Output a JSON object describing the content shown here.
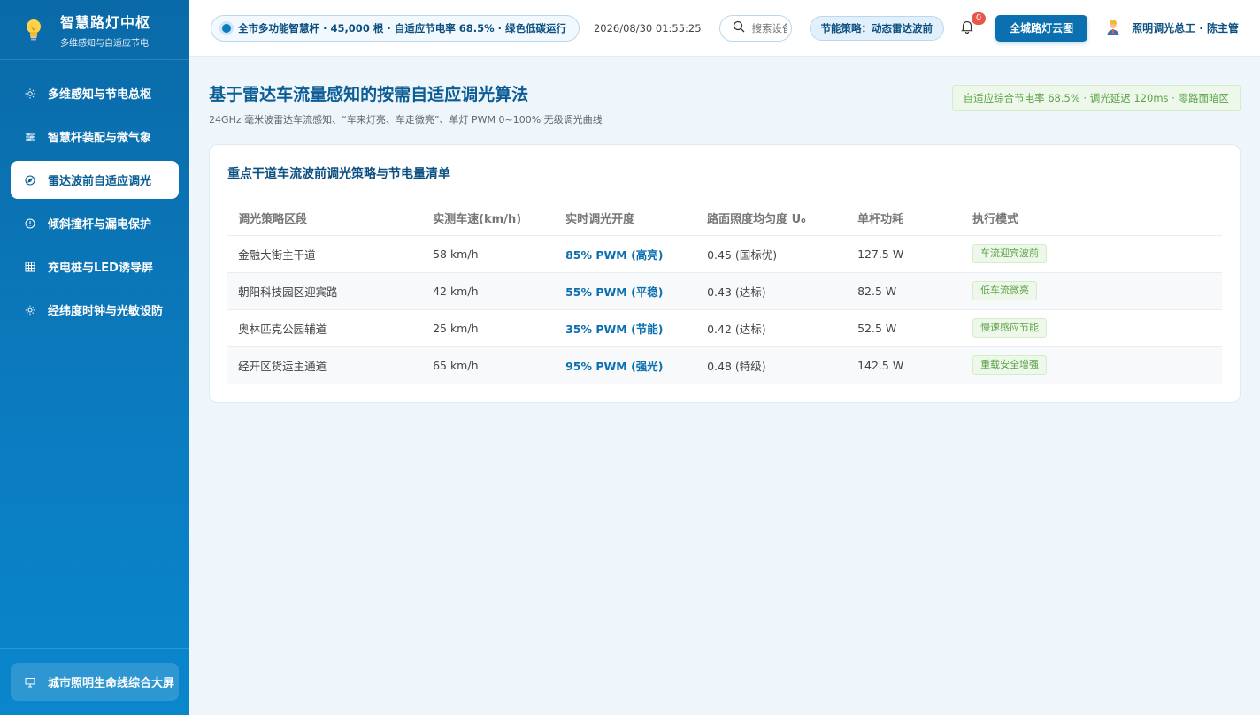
{
  "sidebar": {
    "brand_title": "智慧路灯中枢",
    "brand_subtitle": "多维感知与自适应节电",
    "items": [
      {
        "label": "多维感知与节电总枢",
        "icon": "sun-icon"
      },
      {
        "label": "智慧杆装配与微气象",
        "icon": "sliders-icon"
      },
      {
        "label": "雷达波前自适应调光",
        "icon": "compass-icon",
        "active": true
      },
      {
        "label": "倾斜撞杆与漏电保护",
        "icon": "alert-circle-icon"
      },
      {
        "label": "充电桩与LED诱导屏",
        "icon": "grid-icon"
      },
      {
        "label": "经纬度时钟与光敏设防",
        "icon": "gear-icon"
      }
    ],
    "footer_label": "城市照明生命线综合大屏"
  },
  "topbar": {
    "status_text": "全市多功能智慧杆 · 45,000 根 · 自适应节电率 68.5% · 绿色低碳运行",
    "datetime": "2026/08/30 01:55:25",
    "search_placeholder": "搜索设备",
    "strategy_label": "节能策略：动态雷达波前",
    "notification_count": "0",
    "cloud_button": "全城路灯云图",
    "user_label": "照明调光总工 · 陈主管"
  },
  "page": {
    "title": "基于雷达车流量感知的按需自适应调光算法",
    "subtitle": "24GHz 毫米波雷达车流感知、“车来灯亮、车走微亮”、单灯 PWM 0~100% 无级调光曲线",
    "summary_chip": "自适应综合节电率 68.5% · 调光延迟 120ms · 零路面暗区"
  },
  "table": {
    "title": "重点干道车流波前调光策略与节电量清单",
    "headers": [
      "调光策略区段",
      "实测车速(km/h)",
      "实时调光开度",
      "路面照度均匀度 U₀",
      "单杆功耗",
      "执行模式"
    ],
    "rows": [
      {
        "section": "金融大街主干道",
        "speed": "58 km/h",
        "pwm": "85% PWM (高亮)",
        "uniformity": "0.45 (国标优)",
        "power": "127.5 W",
        "mode": "车流迎宾波前"
      },
      {
        "section": "朝阳科技园区迎宾路",
        "speed": "42 km/h",
        "pwm": "55% PWM (平稳)",
        "uniformity": "0.43 (达标)",
        "power": "82.5 W",
        "mode": "低车流微亮"
      },
      {
        "section": "奥林匹克公园辅道",
        "speed": "25 km/h",
        "pwm": "35% PWM (节能)",
        "uniformity": "0.42 (达标)",
        "power": "52.5 W",
        "mode": "慢速感应节能"
      },
      {
        "section": "经开区货运主通道",
        "speed": "65 km/h",
        "pwm": "95% PWM (强光)",
        "uniformity": "0.48 (特级)",
        "power": "142.5 W",
        "mode": "重载安全增强"
      }
    ]
  }
}
